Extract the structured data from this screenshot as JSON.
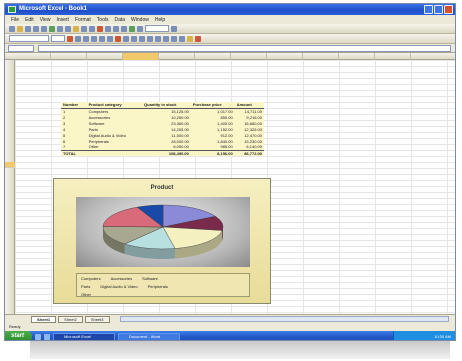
{
  "window": {
    "title": "Microsoft Excel - Book1"
  },
  "menu": [
    "File",
    "Edit",
    "View",
    "Insert",
    "Format",
    "Tools",
    "Data",
    "Window",
    "Help"
  ],
  "table": {
    "headers": [
      "Number",
      "Product category",
      "Quantity in stock",
      "Purchase price",
      "Amount"
    ],
    "rows": [
      [
        "1",
        "Computers",
        "15,125.00",
        "1,017.00",
        "14,711.00"
      ],
      [
        "2",
        "Accessories",
        "10,250.00",
        "850.00",
        "9,216.00"
      ],
      [
        "3",
        "Software",
        "23,360.00",
        "1,400.00",
        "16,680.00"
      ],
      [
        "4",
        "Parts",
        "14,205.00",
        "1,152.00",
        "12,325.00"
      ],
      [
        "5",
        "Digital Audio & Video",
        "11,500.00",
        "912.00",
        "12,470.00"
      ],
      [
        "6",
        "Peripherals",
        "28,000.00",
        "1,840.00",
        "15,230.00"
      ],
      [
        "7",
        "Other",
        "6,050.00",
        "985.00",
        "6,140.00"
      ]
    ],
    "total": [
      "TOTAL",
      "",
      "108,490.00",
      "8,156.00",
      "86,772.00"
    ]
  },
  "chart_data": {
    "type": "pie",
    "title": "Product",
    "categories": [
      "Computers",
      "Accessories",
      "Software",
      "Parts",
      "Digital Audio & Video",
      "Peripherals",
      "Other"
    ],
    "values": [
      14711,
      9216,
      16680,
      12325,
      12470,
      15230,
      6140
    ],
    "colors": [
      "#8a8ad8",
      "#7a2a4a",
      "#f4f0c0",
      "#b8e0e0",
      "#a8a890",
      "#d86a7a",
      "#1a4aa8"
    ],
    "legend": [
      [
        "Computers",
        "Accessories",
        "Software"
      ],
      [
        "Parts",
        "Digital Audio & Video",
        "Peripherals"
      ],
      [
        "Other",
        "",
        ""
      ]
    ],
    "legend_position": "bottom"
  },
  "sheets": [
    "Sheet1",
    "Sheet2",
    "Sheet3"
  ],
  "status": "Ready",
  "taskbar": {
    "start": "start",
    "items": [
      "Microsoft Excel",
      "Document - Word"
    ],
    "clock": "10:30 AM"
  }
}
